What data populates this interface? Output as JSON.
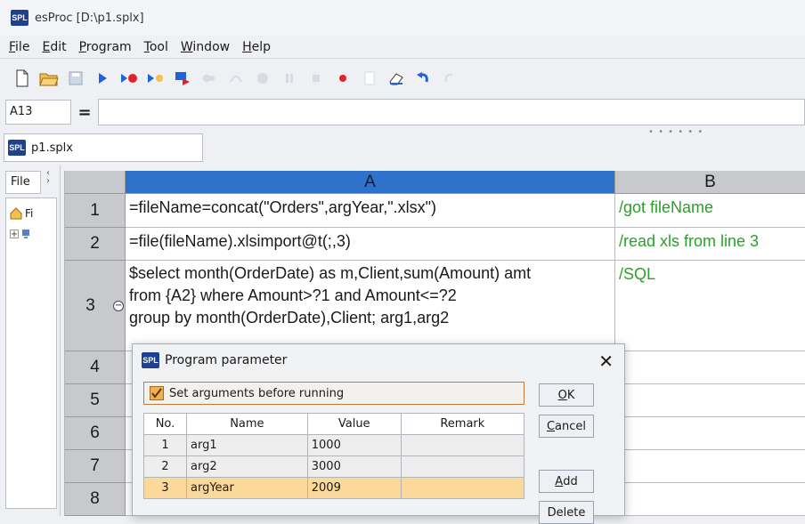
{
  "window": {
    "title": "esProc  [D:\\p1.splx]",
    "logo_text": "SPL"
  },
  "menu": [
    {
      "label": "File",
      "key": "F",
      "rest": "ile"
    },
    {
      "label": "Edit",
      "key": "E",
      "rest": "dit"
    },
    {
      "label": "Program",
      "key": "P",
      "rest": "rogram"
    },
    {
      "label": "Tool",
      "key": "T",
      "rest": "ool"
    },
    {
      "label": "Window",
      "key": "W",
      "rest": "indow"
    },
    {
      "label": "Help",
      "key": "H",
      "rest": "elp"
    }
  ],
  "toolbar_icons": [
    "new-file-icon",
    "open-folder-icon",
    "save-icon",
    "run-icon",
    "run-to-cursor-icon",
    "step-icon",
    "debug-icon",
    "step-into-icon",
    "step-over-icon",
    "stop-icon",
    "pause-icon",
    "stop-square-icon",
    "breakpoint-icon",
    "calc-icon",
    "clear-icon",
    "undo-icon",
    "redo-icon"
  ],
  "formula_bar": {
    "cell_ref": "A13",
    "eq_label": "=",
    "formula": ""
  },
  "file_tab": {
    "label": "p1.splx"
  },
  "left_panel": {
    "tab": "File",
    "root_label": "Fi"
  },
  "grid": {
    "columns": [
      "A",
      "B"
    ],
    "rows": [
      {
        "num": "1",
        "a": "=fileName=concat(\"Orders\",argYear,\".xlsx\")",
        "b": "/got fileName"
      },
      {
        "num": "2",
        "a": "=file(fileName).xlsimport@t(;,3)",
        "b": "/read xls from line 3"
      },
      {
        "num": "3",
        "a": "$select month(OrderDate) as m,Client,sum(Amount) amt\nfrom {A2} where Amount>?1 and Amount<=?2\ngroup by month(OrderDate),Client; arg1,arg2",
        "b": "/SQL"
      },
      {
        "num": "4",
        "a": "",
        "b": ""
      },
      {
        "num": "5",
        "a": "",
        "b": ""
      },
      {
        "num": "6",
        "a": "",
        "b": ""
      },
      {
        "num": "7",
        "a": "",
        "b": ""
      },
      {
        "num": "8",
        "a": "",
        "b": ""
      }
    ]
  },
  "dialog": {
    "title": "Program parameter",
    "close_glyph": "✕",
    "set_args_label": "Set arguments before running",
    "table_headers": [
      "No.",
      "Name",
      "Value",
      "Remark"
    ],
    "params": [
      {
        "no": "1",
        "name": "arg1",
        "value": "1000",
        "remark": ""
      },
      {
        "no": "2",
        "name": "arg2",
        "value": "3000",
        "remark": ""
      },
      {
        "no": "3",
        "name": "argYear",
        "value": "2009",
        "remark": ""
      }
    ],
    "buttons": {
      "ok": {
        "key": "O",
        "rest": "K"
      },
      "cancel": {
        "key": "C",
        "rest": "ancel"
      },
      "add": {
        "key": "A",
        "rest": "dd"
      },
      "delete": {
        "key": "",
        "rest": "Delete"
      }
    }
  }
}
